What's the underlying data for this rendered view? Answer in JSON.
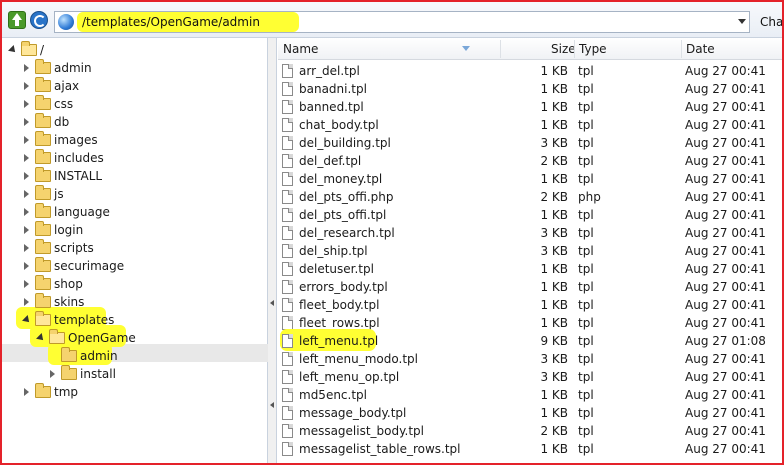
{
  "address": {
    "path": "/templates/OpenGame/admin",
    "side_label": "Chap"
  },
  "tree": {
    "nodes": [
      {
        "label": "/",
        "depth": 0,
        "state": "open"
      },
      {
        "label": "admin",
        "depth": 1,
        "state": "closed"
      },
      {
        "label": "ajax",
        "depth": 1,
        "state": "closed"
      },
      {
        "label": "css",
        "depth": 1,
        "state": "closed"
      },
      {
        "label": "db",
        "depth": 1,
        "state": "closed"
      },
      {
        "label": "images",
        "depth": 1,
        "state": "closed"
      },
      {
        "label": "includes",
        "depth": 1,
        "state": "closed"
      },
      {
        "label": "INSTALL",
        "depth": 1,
        "state": "closed"
      },
      {
        "label": "js",
        "depth": 1,
        "state": "closed"
      },
      {
        "label": "language",
        "depth": 1,
        "state": "closed"
      },
      {
        "label": "login",
        "depth": 1,
        "state": "closed"
      },
      {
        "label": "scripts",
        "depth": 1,
        "state": "closed"
      },
      {
        "label": "securimage",
        "depth": 1,
        "state": "closed"
      },
      {
        "label": "shop",
        "depth": 1,
        "state": "closed"
      },
      {
        "label": "skins",
        "depth": 1,
        "state": "closed"
      },
      {
        "label": "templates",
        "depth": 1,
        "state": "open"
      },
      {
        "label": "OpenGame",
        "depth": 2,
        "state": "open"
      },
      {
        "label": "admin",
        "depth": 3,
        "state": "none"
      },
      {
        "label": "install",
        "depth": 3,
        "state": "closed"
      },
      {
        "label": "tmp",
        "depth": 1,
        "state": "closed"
      }
    ]
  },
  "columns": {
    "name": "Name",
    "size": "Size",
    "type": "Type",
    "date": "Date"
  },
  "files": [
    {
      "name": "arr_del.tpl",
      "size": "1 KB",
      "type": "tpl",
      "date": "Aug 27 00:41"
    },
    {
      "name": "banadni.tpl",
      "size": "1 KB",
      "type": "tpl",
      "date": "Aug 27 00:41"
    },
    {
      "name": "banned.tpl",
      "size": "1 KB",
      "type": "tpl",
      "date": "Aug 27 00:41"
    },
    {
      "name": "chat_body.tpl",
      "size": "1 KB",
      "type": "tpl",
      "date": "Aug 27 00:41"
    },
    {
      "name": "del_building.tpl",
      "size": "3 KB",
      "type": "tpl",
      "date": "Aug 27 00:41"
    },
    {
      "name": "del_def.tpl",
      "size": "2 KB",
      "type": "tpl",
      "date": "Aug 27 00:41"
    },
    {
      "name": "del_money.tpl",
      "size": "1 KB",
      "type": "tpl",
      "date": "Aug 27 00:41"
    },
    {
      "name": "del_pts_offi.php",
      "size": "2 KB",
      "type": "php",
      "date": "Aug 27 00:41"
    },
    {
      "name": "del_pts_offi.tpl",
      "size": "1 KB",
      "type": "tpl",
      "date": "Aug 27 00:41"
    },
    {
      "name": "del_research.tpl",
      "size": "3 KB",
      "type": "tpl",
      "date": "Aug 27 00:41"
    },
    {
      "name": "del_ship.tpl",
      "size": "3 KB",
      "type": "tpl",
      "date": "Aug 27 00:41"
    },
    {
      "name": "deletuser.tpl",
      "size": "1 KB",
      "type": "tpl",
      "date": "Aug 27 00:41"
    },
    {
      "name": "errors_body.tpl",
      "size": "1 KB",
      "type": "tpl",
      "date": "Aug 27 00:41"
    },
    {
      "name": "fleet_body.tpl",
      "size": "1 KB",
      "type": "tpl",
      "date": "Aug 27 00:41"
    },
    {
      "name": "fleet_rows.tpl",
      "size": "1 KB",
      "type": "tpl",
      "date": "Aug 27 00:41"
    },
    {
      "name": "left_menu.tpl",
      "size": "9 KB",
      "type": "tpl",
      "date": "Aug 27 01:08"
    },
    {
      "name": "left_menu_modo.tpl",
      "size": "3 KB",
      "type": "tpl",
      "date": "Aug 27 00:41"
    },
    {
      "name": "left_menu_op.tpl",
      "size": "3 KB",
      "type": "tpl",
      "date": "Aug 27 00:41"
    },
    {
      "name": "md5enc.tpl",
      "size": "1 KB",
      "type": "tpl",
      "date": "Aug 27 00:41"
    },
    {
      "name": "message_body.tpl",
      "size": "1 KB",
      "type": "tpl",
      "date": "Aug 27 00:41"
    },
    {
      "name": "messagelist_body.tpl",
      "size": "2 KB",
      "type": "tpl",
      "date": "Aug 27 00:41"
    },
    {
      "name": "messagelist_table_rows.tpl",
      "size": "1 KB",
      "type": "tpl",
      "date": "Aug 27 00:41"
    }
  ],
  "colors": {
    "highlight": "#ffff33",
    "border": "#e4222a"
  }
}
